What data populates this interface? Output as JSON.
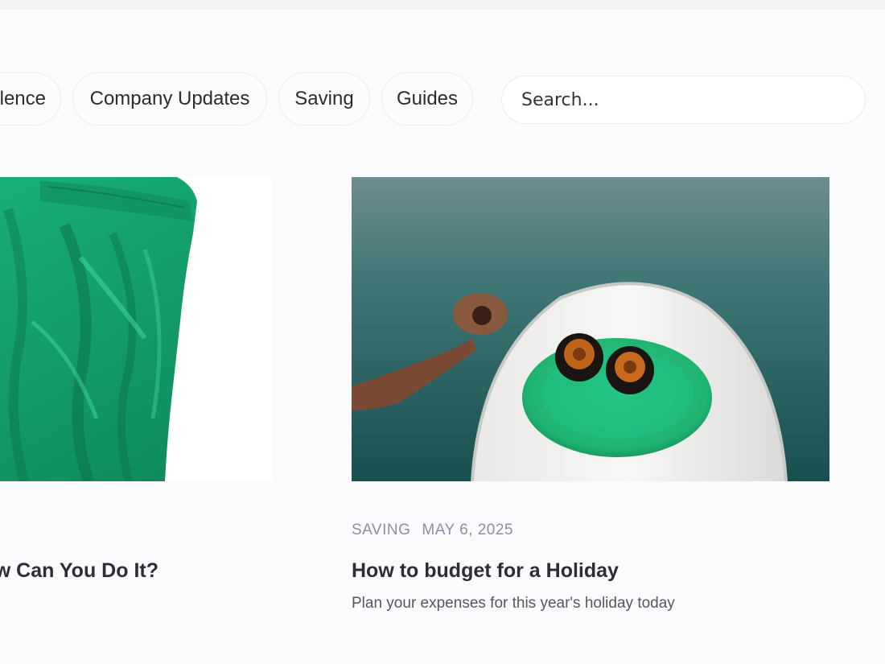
{
  "filters": {
    "items": [
      {
        "label": "lence"
      },
      {
        "label": "Company Updates"
      },
      {
        "label": "Saving"
      },
      {
        "label": "Guides"
      }
    ]
  },
  "search": {
    "placeholder": "Search..."
  },
  "cards": [
    {
      "title": "w Can You Do It?",
      "image": "green-crinkled-fabric-image"
    },
    {
      "category": "SAVING",
      "date": "MAY 6, 2025",
      "title": "How to budget for a Holiday",
      "description": "Plan your expenses for this year's holiday today",
      "image": "sea-urchins-on-green-plate-image"
    }
  ],
  "colors": {
    "background": "#fbfbfd",
    "chip_border": "#ececf1",
    "meta_text": "#8d8ea0",
    "title_text": "#2d2d35",
    "green_accent": "#1fbf7f",
    "sea": "#2f6a6c"
  }
}
